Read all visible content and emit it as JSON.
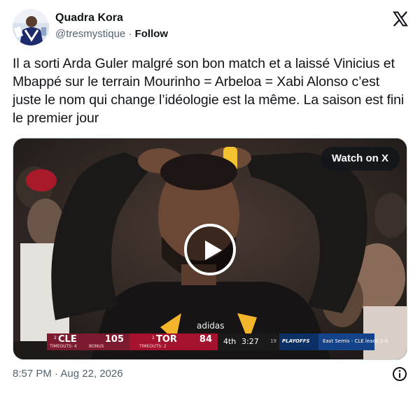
{
  "author": {
    "display_name": "Quadra Kora",
    "handle": "@tresmystique",
    "separator": "·",
    "follow_label": "Follow"
  },
  "tweet": {
    "text": "Il a sorti Arda Guler malgré son bon match et a laissé Vinicius et Mbappé sur le terrain Mourinho = Arbeloa = Xabi Alonso c’est juste le nom qui change l’idéologie est la même. La saison est fini le premier jour"
  },
  "media": {
    "watch_label": "Watch on X",
    "scorebug": {
      "team1_seed": "2",
      "team1_abbr": "CLE",
      "team1_score": "105",
      "team1_timeouts": "TIMEOUTS: 4",
      "team1_bonus": "BONUS",
      "team2_seed": "1",
      "team2_abbr": "TOR",
      "team2_score": "84",
      "team2_timeouts": "TIMEOUTS: 2",
      "quarter": "4th",
      "clock": "3:27",
      "shot_clock": "19",
      "playoffs_label": "PLAYOFFS",
      "series_text": "East Semis - CLE leads 2-0"
    }
  },
  "footer": {
    "timestamp": "8:57 PM · Aug 22, 2026"
  },
  "icons": {
    "x_logo": "x-logo-icon",
    "info": "info-icon",
    "play": "play-icon"
  },
  "colors": {
    "text_primary": "#0f1419",
    "text_secondary": "#536471",
    "cle_wine": "#7c1b2f",
    "tor_red": "#a4122d"
  }
}
